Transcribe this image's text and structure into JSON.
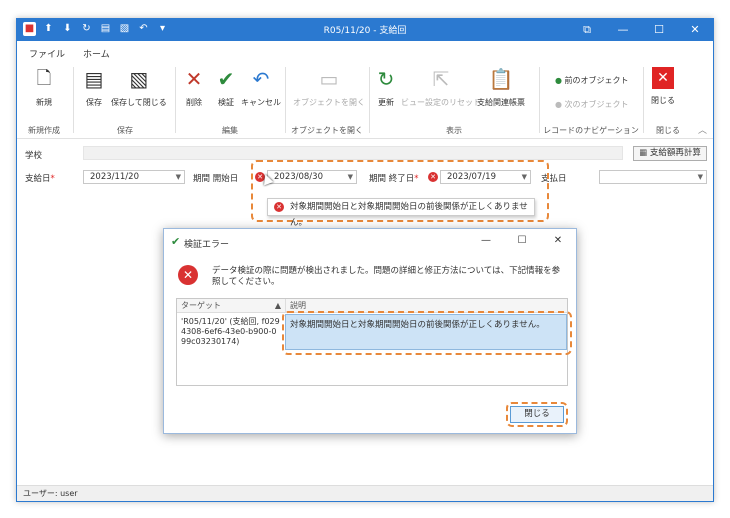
{
  "window": {
    "title": "R05/11/20 - 支給回",
    "controls": [
      "⧉",
      "—",
      "☐",
      "✕"
    ]
  },
  "tabs": [
    {
      "label": "ファイル"
    },
    {
      "label": "ホーム"
    }
  ],
  "ribbon": {
    "buttons": {
      "new": "新規",
      "save": "保存",
      "save_close": "保存して閉じる",
      "delete": "削除",
      "validate": "検証",
      "cancel": "キャンセル",
      "open_object": "オブジェクトを開く",
      "refresh": "更新",
      "reset_view": "ビュー設定のリセット",
      "report": "支給関連帳票",
      "close": "閉じる"
    },
    "nav": {
      "prev": "前のオブジェクト",
      "next": "次のオブジェクト"
    },
    "groups": {
      "new_create": "新規作成",
      "save": "保存",
      "edit": "編集",
      "open_object": "オブジェクトを開く",
      "display": "表示",
      "record_nav": "レコードのナビゲーション",
      "close": "閉じる"
    }
  },
  "form": {
    "school_label": "学校",
    "recalc_button": "支給額再計算",
    "pay_date_label": "支給日",
    "pay_date_value": "2023/11/20",
    "period_start_label": "期間 開始日",
    "period_start_value": "2023/08/30",
    "period_end_label": "期間 終了日",
    "period_end_value": "2023/07/19",
    "payment_date_label": "支払日",
    "payment_date_value": "",
    "required_mark": "*",
    "tooltip": "対象期間開始日と対象期間開始日の前後関係が正しくありません。"
  },
  "status": {
    "user_text": "ユーザー: user"
  },
  "dialog": {
    "title": "検証エラー",
    "message": "データ検証の際に問題が検出されました。問題の詳細と修正方法については、下記情報を参照してください。",
    "columns": {
      "target": "ターゲット",
      "description": "説明"
    },
    "row": {
      "target": "'R05/11/20' (支給回, f0294308-6ef6-43e0-b900-099c03230174)",
      "description": "対象期間開始日と対象期間開始日の前後関係が正しくありません。"
    },
    "close_label": "閉じる",
    "controls": [
      "—",
      "☐",
      "✕"
    ]
  }
}
